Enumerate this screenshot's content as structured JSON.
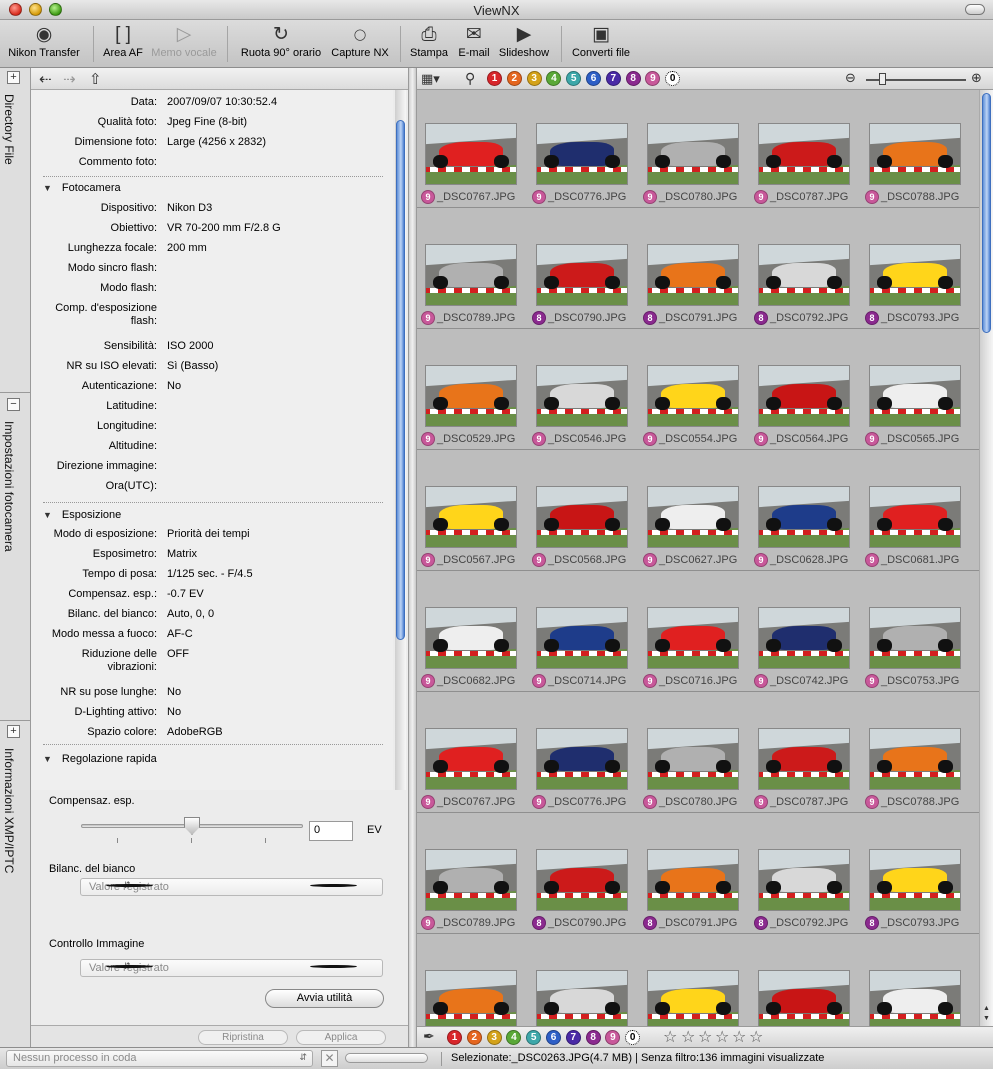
{
  "window": {
    "title": "ViewNX"
  },
  "toolbar": {
    "nikon_transfer": "Nikon Transfer",
    "area_af": "Area AF",
    "memo_vocale": "Memo vocale",
    "ruota": "Ruota 90° orario",
    "capture_nx": "Capture NX",
    "stampa": "Stampa",
    "email": "E-mail",
    "slideshow": "Slideshow",
    "converti": "Converti file"
  },
  "side_tabs": [
    "Directory File",
    "Impostazioni fotocamera",
    "Informazioni XMP/IPTC"
  ],
  "file_info": [
    {
      "k": "Data:",
      "v": "2007/09/07 10:30:52.4"
    },
    {
      "k": "Qualità foto:",
      "v": "Jpeg Fine (8-bit)"
    },
    {
      "k": "Dimensione foto:",
      "v": "Large (4256 x 2832)"
    },
    {
      "k": "Commento foto:",
      "v": ""
    }
  ],
  "fotocamera": {
    "title": "Fotocamera",
    "rows": [
      {
        "k": "Dispositivo:",
        "v": "Nikon D3"
      },
      {
        "k": "Obiettivo:",
        "v": "VR 70-200 mm F/2.8 G"
      },
      {
        "k": "Lunghezza focale:",
        "v": "200 mm"
      },
      {
        "k": "Modo sincro flash:",
        "v": ""
      },
      {
        "k": "Modo flash:",
        "v": ""
      },
      {
        "k": "Comp. d'esposizione",
        "k2": "flash:",
        "v": ""
      },
      {
        "k": "Sensibilità:",
        "v": "ISO 2000"
      },
      {
        "k": "NR su ISO elevati:",
        "v": "Sì (Basso)"
      },
      {
        "k": "Autenticazione:",
        "v": "No"
      },
      {
        "k": "Latitudine:",
        "v": ""
      },
      {
        "k": "Longitudine:",
        "v": ""
      },
      {
        "k": "Altitudine:",
        "v": ""
      },
      {
        "k": "Direzione immagine:",
        "v": ""
      },
      {
        "k": "Ora(UTC):",
        "v": ""
      }
    ]
  },
  "esposizione": {
    "title": "Esposizione",
    "rows": [
      {
        "k": "Modo di esposizione:",
        "v": "Priorità dei tempi"
      },
      {
        "k": "Esposimetro:",
        "v": "Matrix"
      },
      {
        "k": "Tempo di posa:",
        "v": "1/125 sec. - F/4.5"
      },
      {
        "k": "Compensaz. esp.:",
        "v": "-0.7 EV"
      },
      {
        "k": "Bilanc. del bianco:",
        "v": "Auto, 0, 0"
      },
      {
        "k": "Modo messa a fuoco:",
        "v": "AF-C"
      },
      {
        "k": "Riduzione delle",
        "k2": "vibrazioni:",
        "v": "OFF"
      },
      {
        "k": "NR su pose lunghe:",
        "v": "No"
      },
      {
        "k": "D-Lighting attivo:",
        "v": "No"
      },
      {
        "k": "Spazio colore:",
        "v": "AdobeRGB"
      }
    ]
  },
  "regolazione": {
    "title": "Regolazione rapida",
    "comp_label": "Compensaz. esp.",
    "comp_value": "0",
    "comp_unit": "EV",
    "wb_label": "Bilanc. del bianco",
    "wb_value": "Valore registrato",
    "ci_label": "Controllo Immagine",
    "ci_value": "Valore registrato",
    "avvia": "Avvia utilità",
    "ripristina": "Ripristina",
    "applica": "Applica"
  },
  "labels": [
    "1",
    "2",
    "3",
    "4",
    "5",
    "6",
    "7",
    "8",
    "9",
    "0"
  ],
  "label_colors": [
    "#d8262b",
    "#e5661f",
    "#d4a21a",
    "#5aa837",
    "#3da7a9",
    "#2e5fc6",
    "#4a2aa6",
    "#8b2a8f",
    "#c8589a",
    "#ffffff"
  ],
  "thumbs": [
    {
      "n": "_DSC0767.JPG",
      "l": "9"
    },
    {
      "n": "_DSC0776.JPG",
      "l": "9"
    },
    {
      "n": "_DSC0780.JPG",
      "l": "9"
    },
    {
      "n": "_DSC0787.JPG",
      "l": "9"
    },
    {
      "n": "_DSC0788.JPG",
      "l": "9"
    },
    {
      "n": "_DSC0789.JPG",
      "l": "9"
    },
    {
      "n": "_DSC0790.JPG",
      "l": "8"
    },
    {
      "n": "_DSC0791.JPG",
      "l": "8"
    },
    {
      "n": "_DSC0792.JPG",
      "l": "8"
    },
    {
      "n": "_DSC0793.JPG",
      "l": "8"
    },
    {
      "n": "_DSC0529.JPG",
      "l": "9"
    },
    {
      "n": "_DSC0546.JPG",
      "l": "9"
    },
    {
      "n": "_DSC0554.JPG",
      "l": "9"
    },
    {
      "n": "_DSC0564.JPG",
      "l": "9"
    },
    {
      "n": "_DSC0565.JPG",
      "l": "9"
    },
    {
      "n": "_DSC0567.JPG",
      "l": "9"
    },
    {
      "n": "_DSC0568.JPG",
      "l": "9"
    },
    {
      "n": "_DSC0627.JPG",
      "l": "9"
    },
    {
      "n": "_DSC0628.JPG",
      "l": "9"
    },
    {
      "n": "_DSC0681.JPG",
      "l": "9"
    },
    {
      "n": "_DSC0682.JPG",
      "l": "9"
    },
    {
      "n": "_DSC0714.JPG",
      "l": "9"
    },
    {
      "n": "_DSC0716.JPG",
      "l": "9"
    },
    {
      "n": "_DSC0742.JPG",
      "l": "9"
    },
    {
      "n": "_DSC0753.JPG",
      "l": "9"
    },
    {
      "n": "_DSC0767.JPG",
      "l": "9"
    },
    {
      "n": "_DSC0776.JPG",
      "l": "9"
    },
    {
      "n": "_DSC0780.JPG",
      "l": "9"
    },
    {
      "n": "_DSC0787.JPG",
      "l": "9"
    },
    {
      "n": "_DSC0788.JPG",
      "l": "9"
    },
    {
      "n": "_DSC0789.JPG",
      "l": "9"
    },
    {
      "n": "_DSC0790.JPG",
      "l": "8"
    },
    {
      "n": "_DSC0791.JPG",
      "l": "8"
    },
    {
      "n": "_DSC0792.JPG",
      "l": "8"
    },
    {
      "n": "_DSC0793.JPG",
      "l": "8"
    },
    {
      "n": "",
      "l": ""
    },
    {
      "n": "",
      "l": ""
    },
    {
      "n": "",
      "l": ""
    },
    {
      "n": "",
      "l": ""
    },
    {
      "n": "",
      "l": ""
    }
  ],
  "status": {
    "queue": "Nessun processo in coda",
    "text": "Selezionate:_DSC0263.JPG(4.7 MB) | Senza filtro:136 immagini visualizzate"
  }
}
